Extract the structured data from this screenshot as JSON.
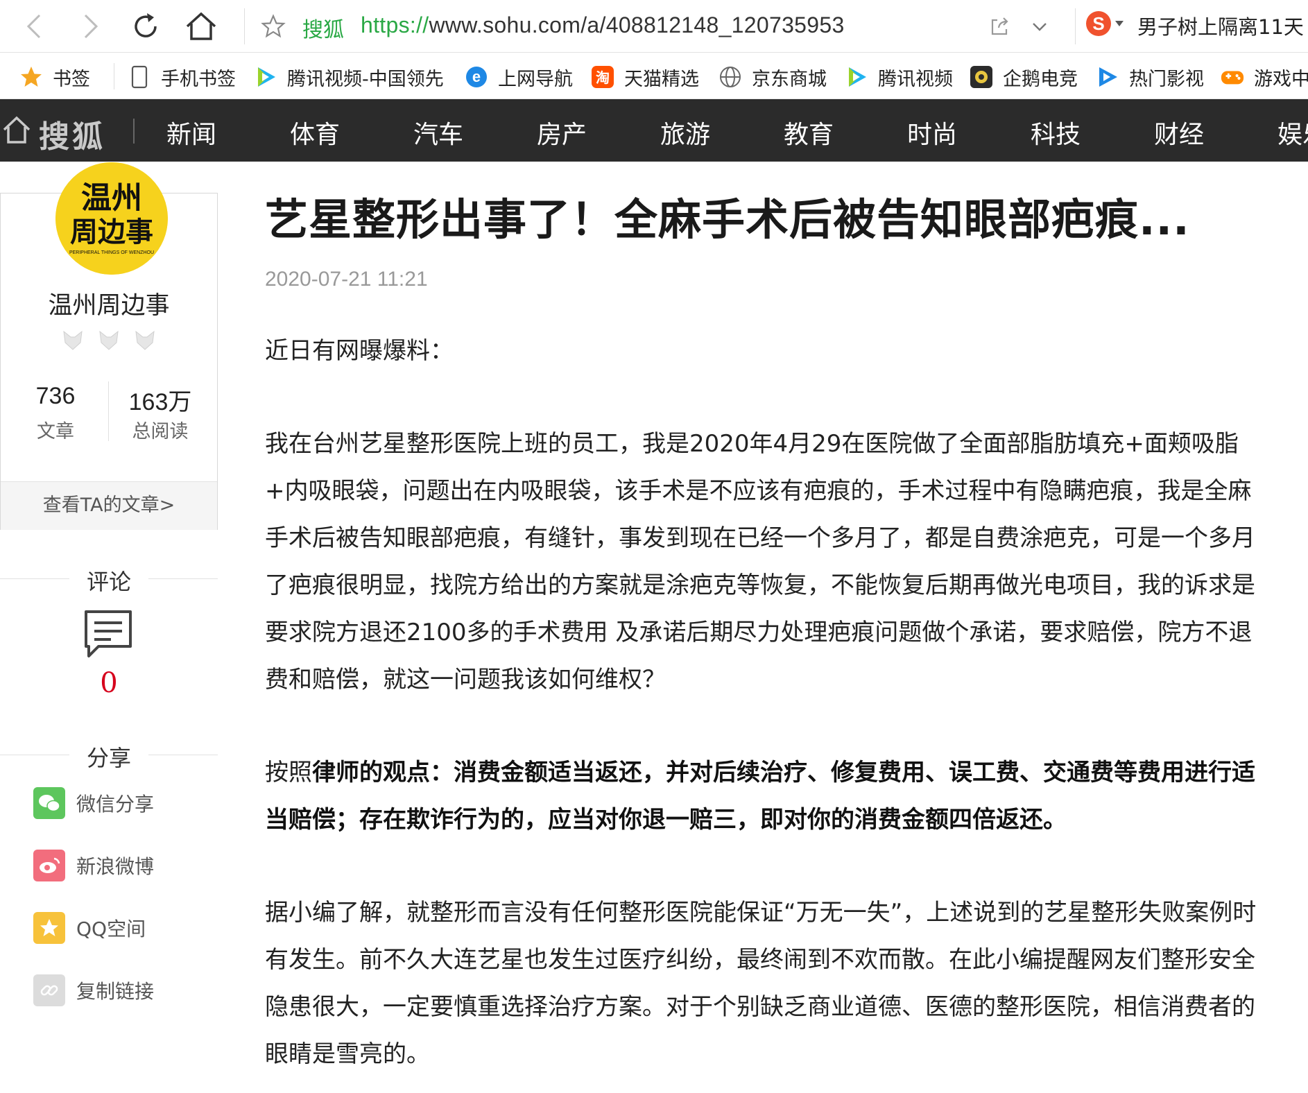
{
  "browser": {
    "site_name": "搜狐",
    "url_scheme": "https://",
    "url_rest": "www.sohu.com/a/408812148_120735953",
    "search_text": "男子树上隔离11天"
  },
  "bookmarks": [
    {
      "label": "书签",
      "icon": "star-icon"
    },
    {
      "label": "手机书签",
      "icon": "phone-icon"
    },
    {
      "label": "腾讯视频-中国领先",
      "icon": "tencent-video-icon"
    },
    {
      "label": "上网导航",
      "icon": "ie-icon"
    },
    {
      "label": "天猫精选",
      "icon": "tmall-icon"
    },
    {
      "label": "京东商城",
      "icon": "globe-icon"
    },
    {
      "label": "腾讯视频",
      "icon": "tencent-video-icon"
    },
    {
      "label": "企鹅电竞",
      "icon": "penguin-esports-icon"
    },
    {
      "label": "热门影视",
      "icon": "play-icon"
    },
    {
      "label": "游戏中",
      "icon": "gamepad-icon"
    }
  ],
  "site_nav": {
    "logo": "搜狐",
    "items": [
      "新闻",
      "体育",
      "汽车",
      "房产",
      "旅游",
      "教育",
      "时尚",
      "科技",
      "财经",
      "娱乐"
    ]
  },
  "author": {
    "avatar_text_line1": "温州",
    "avatar_text_line2": "周边事",
    "avatar_subtext": "PERIPHERAL THINGS OF WENZHOU",
    "name": "温州周边事",
    "articles_count": "736",
    "articles_label": "文章",
    "reads_count": "163万",
    "reads_label": "总阅读",
    "view_link": "查看TA的文章>"
  },
  "comments": {
    "title": "评论",
    "count": "0"
  },
  "share": {
    "title": "分享",
    "items": [
      {
        "label": "微信分享",
        "color": "#5dc65d"
      },
      {
        "label": "新浪微博",
        "color": "#f26d7d"
      },
      {
        "label": "QQ空间",
        "color": "#f7c23b"
      },
      {
        "label": "复制链接",
        "color": "#dcdcdc"
      }
    ]
  },
  "article": {
    "title": "艺星整形出事了！全麻手术后被告知眼部疤痕...",
    "time": "2020-07-21 11:21",
    "intro": "近日有网曝爆料：",
    "p1": "我在台州艺星整形医院上班的员工，我是2020年4月29在医院做了全面部脂肪填充+面颊吸脂+内吸眼袋，问题出在内吸眼袋，该手术是不应该有疤痕的，手术过程中有隐瞒疤痕，我是全麻手术后被告知眼部疤痕，有缝针，事发到现在已经一个多月了，都是自费涂疤克，可是一个多月了疤痕很明显，找院方给出的方案就是涂疤克等恢复，不能恢复后期再做光电项目，我的诉求是 要求院方退还2100多的手术费用 及承诺后期尽力处理疤痕问题做个承诺，要求赔偿，院方不退费和赔偿，就这一问题我该如何维权？",
    "p2_prefix": "按照",
    "p2_bold": "律师的观点：消费金额适当返还，并对后续治疗、修复费用、误工费、交通费等费用进行适当赔偿；存在欺诈行为的，应当对你退一赔三，即对你的消费金额四倍返还。",
    "p3": "据小编了解，就整形而言没有任何整形医院能保证“万无一失”，上述说到的艺星整形失败案例时有发生。前不久大连艺星也发生过医疗纠纷，最终闹到不欢而散。在此小编提醒网友们整形安全隐患很大，一定要慎重选择治疗方案。对于个别缺乏商业道德、医德的整形医院，相信消费者的眼睛是雪亮的。"
  }
}
